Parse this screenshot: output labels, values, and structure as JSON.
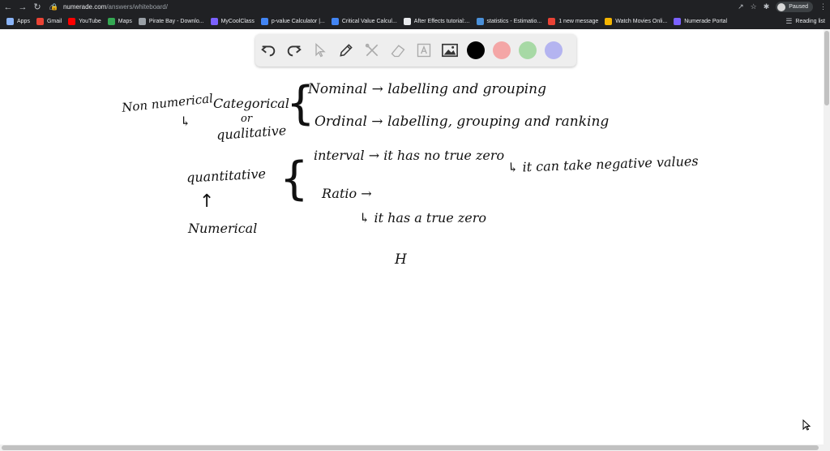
{
  "browser": {
    "url_host": "numerade.com",
    "url_path": "/answers/whiteboard/",
    "profile_label": "Paused",
    "bookmarks": [
      {
        "label": "Apps",
        "color": "#8ab4f8"
      },
      {
        "label": "Gmail",
        "color": "#ea4335"
      },
      {
        "label": "YouTube",
        "color": "#ff0000"
      },
      {
        "label": "Maps",
        "color": "#34a853"
      },
      {
        "label": "Pirate Bay - Downlo...",
        "color": "#9aa0a6"
      },
      {
        "label": "MyCoolClass",
        "color": "#7b61ff"
      },
      {
        "label": "p-value Calculator |...",
        "color": "#4285f4"
      },
      {
        "label": "Critical Value Calcul...",
        "color": "#4285f4"
      },
      {
        "label": "After Effects tutorial:...",
        "color": "#e8eaed"
      },
      {
        "label": "statistics - Estimatio...",
        "color": "#4a90d9"
      },
      {
        "label": "1 new message",
        "color": "#e94235"
      },
      {
        "label": "Watch Movies Onli...",
        "color": "#f4b400"
      },
      {
        "label": "Numerade Portal",
        "color": "#7b61ff"
      }
    ],
    "reading_list": "Reading list"
  },
  "toolbar": {
    "tools": [
      "undo-icon",
      "redo-icon",
      "select-icon",
      "pen-icon",
      "tools-icon",
      "eraser-icon",
      "text-icon",
      "image-icon"
    ],
    "colors": [
      "#000000",
      "#f4a6a6",
      "#a7d9a5",
      "#b4b4f0"
    ]
  },
  "whiteboard": {
    "nonnumerical": "Non numerical",
    "arrow_1": "↳",
    "categorical": "Categorical",
    "or": "or",
    "qualitative": "qualitative",
    "nominal": "Nominal → labelling and grouping",
    "ordinal": "Ordinal → labelling, grouping and ranking",
    "quantitative": "quantitative",
    "interval": "interval → it has no true zero",
    "interval_note": "↳ it can take negative values",
    "ratio": "Ratio →",
    "ratio_note": "↳ it has a true zero",
    "numerical": "Numerical",
    "h": "H"
  }
}
